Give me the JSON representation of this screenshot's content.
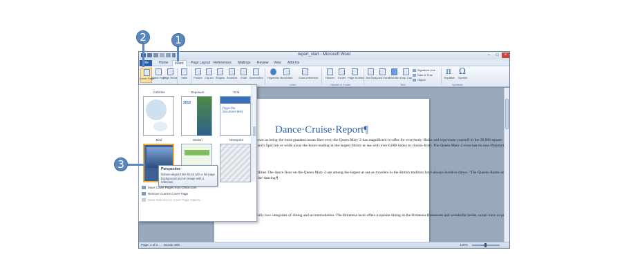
{
  "window": {
    "title": "report_start - Microsoft Word"
  },
  "tabs": [
    {
      "label": "File"
    },
    {
      "label": "Home"
    },
    {
      "label": "Insert"
    },
    {
      "label": "Page Layout"
    },
    {
      "label": "References"
    },
    {
      "label": "Mailings"
    },
    {
      "label": "Review"
    },
    {
      "label": "View"
    },
    {
      "label": "Add-Ins"
    }
  ],
  "ribbon": {
    "buttons": [
      {
        "label": "Cover Page"
      },
      {
        "label": "Blank Page"
      },
      {
        "label": "Page Break"
      },
      {
        "label": "Table"
      },
      {
        "label": "Picture"
      },
      {
        "label": "Clip Art"
      },
      {
        "label": "Shapes"
      },
      {
        "label": "SmartArt"
      },
      {
        "label": "Chart"
      },
      {
        "label": "Screenshot"
      },
      {
        "label": "Hyperlink"
      },
      {
        "label": "Bookmark"
      },
      {
        "label": "Cross-reference"
      },
      {
        "label": "Header"
      },
      {
        "label": "Footer"
      },
      {
        "label": "Page Number"
      },
      {
        "label": "Text Box"
      },
      {
        "label": "Quick Parts"
      },
      {
        "label": "WordArt"
      },
      {
        "label": "Drop Cap"
      },
      {
        "label": "Equation"
      },
      {
        "label": "Symbol"
      }
    ],
    "text_group_items": [
      "Signature Line",
      "Date & Time",
      "Object"
    ],
    "groups": {
      "links": "Links",
      "header_footer": "Header & Footer",
      "text": "Text",
      "symbols": "Symbols"
    }
  },
  "gallery": {
    "captions": {
      "cubicles": "Cubicles",
      "exposure": "Exposure",
      "grid": "Grid",
      "mod": "Mod",
      "motion": "Motion",
      "newsprint": "Newsprint"
    },
    "newsprint_placeholder": "[Type the document title]",
    "motion_label": "2012",
    "menu": [
      {
        "label": "More Cover Pages from Office.com",
        "disabled": false
      },
      {
        "label": "Remove Current Cover Page",
        "disabled": false
      },
      {
        "label": "Save Selection to Cover Page Gallery...",
        "disabled": true
      }
    ]
  },
  "tooltip": {
    "title": "Perspective",
    "body": "Bottom-aligned title block with a full page background and an image with a reflection"
  },
  "document": {
    "title": "Dance·Cruise·Report¶",
    "p1": "Attractions·Known·as·being·the·most·grandest·ocean·liner·ever,·the·Queen·Mary·2·has·magnificent·to·offer·for·everybody.·Relax·and·rejuvenate·yourself·in·the·20,000·square-foot·Canyon·Ranch·SpaClub·or·while·away·the·hours·reading·in·the·largest·library·at·sea·with·over·8,000·books·to·choose·from.·The·Queen·Mary·2·even·has·its·own·Planetarium·where·you·can·enjoy·presentations·and·virtual·journeys·into·space.¶",
    "p2": "The·Dance·Facilities·The·dance·floor·on·the·Queen·Mary·2·are·among·the·largest·at·sea·as·travelers·in·the·British·tradition·have·always·loved·to·dance.·\"The·Queens·Room·on·the·Queen·Mary·2·is·perfect·for·traditional·social·ballroom·dancing.\"·Plan·to·dance·the·night·away·at·one·of·the·famous·\"Royal·Night\"·formal·balls.·Expect·an·Orchestra·on·board·as·well·as·a·band.·Both·ballroom·and·band·play·wonderful·ballroom·dance·music.·There·are·always·experienced·dance·hosts·on·board·offering·both·group·and·private·dance·lessons·in·everything·from·social·ballroom,·salsa,·cha-cha,·Latin·to·Line·dancing.¶",
    "p3": "There·are·basically·two·categories·of·dining·and·accommodation.·The·Britannia·level·offers·exquisite·dining·in·the·Britannia·Restaurant·and·wonderful·inside,·ocean·view·or·premium·balcony·stateroom·ranging·in·size·from·157·square·feet·(standard·inside·cabin)·to·248·square·feet·(Deluxe·Balcony).·The·Queens·Grill·Accommodation·offers·the·height·of·sophistication·with·dining·in·the·Queens·Grill·and·large·suites·(approximately·506·square·feet),·penthouses·(approximately·796·square·feet)·to·the·grand·duplexes·as·large·as·2,249·square·feet.¶"
  },
  "status": {
    "page": "Page: 1 of 2",
    "words": "Words: 808",
    "zoom": "100%"
  },
  "callouts": [
    "1",
    "2",
    "3"
  ],
  "colors": {
    "accent": "#5c87bd",
    "file_tab": "#2b5fae",
    "title_blue": "#2f64b0",
    "selection": "#f2b03a"
  }
}
